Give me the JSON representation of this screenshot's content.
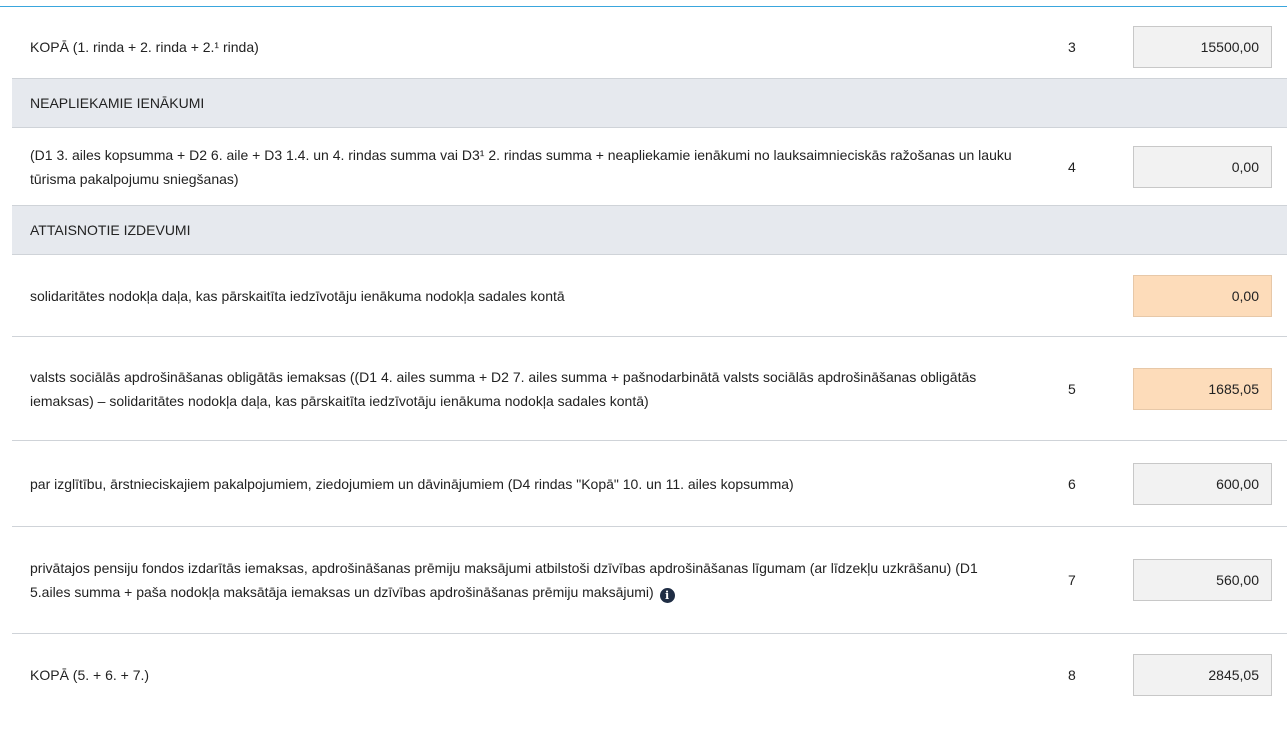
{
  "rows": [
    {
      "id": "row-3",
      "text": "KOPĀ (1. rinda + 2. rinda + 2.¹ rinda)",
      "num": "3",
      "value": "15500,00"
    },
    {
      "id": "section-neapliekamie",
      "text": "NEAPLIEKAMIE IENĀKUMI"
    },
    {
      "id": "row-4",
      "text": "(D1 3. ailes kopsumma + D2 6. aile + D3 1.4. un 4. rindas summa vai D3¹ 2. rindas summa + neapliekamie ienākumi no lauksaimnieciskās ražošanas un lauku tūrisma pakalpojumu sniegšanas)",
      "num": "4",
      "value": "0,00"
    },
    {
      "id": "section-attaisnotie",
      "text": "ATTAISNOTIE IZDEVUMI"
    },
    {
      "id": "row-solidaritate",
      "text": "solidaritātes nodokļa daļa, kas pārskaitīta iedzīvotāju ienākuma nodokļa sadales kontā",
      "num": "",
      "value": "0,00"
    },
    {
      "id": "row-5",
      "text": "valsts sociālās apdrošināšanas obligātās iemaksas ((D1 4. ailes summa + D2 7. ailes summa + pašnodarbinātā valsts sociālās apdrošināšanas obligātās iemaksas) – solidaritātes nodokļa daļa, kas pārskaitīta iedzīvotāju ienākuma nodokļa sadales kontā)",
      "num": "5",
      "value": "1685,05"
    },
    {
      "id": "row-6",
      "text": "par izglītību, ārstnieciskajiem pakalpojumiem, ziedojumiem un dāvinājumiem (D4 rindas \"Kopā\" 10. un 11. ailes kopsumma)",
      "num": "6",
      "value": "600,00"
    },
    {
      "id": "row-7",
      "text": "privātajos pensiju fondos izdarītās iemaksas, apdrošināšanas prēmiju maksājumi atbilstoši dzīvības apdrošināšanas līgumam (ar līdzekļu uzkrāšanu) (D1 5.ailes summa + paša nodokļa maksātāja iemaksas un dzīvības apdrošināšanas prēmiju maksājumi)",
      "num": "7",
      "value": "560,00",
      "icon": "i"
    },
    {
      "id": "row-8",
      "text": "KOPĀ (5. + 6. + 7.)",
      "num": "8",
      "value": "2845,05"
    }
  ],
  "colors": {
    "field_bg": "#f2f2f2",
    "field_highlight_bg": "#fddcba",
    "section_bg": "#e6e9ee",
    "accent_line": "#3aa6dd",
    "info_icon": "#1f2d44"
  },
  "icons": {
    "info": "info-circle-icon"
  }
}
